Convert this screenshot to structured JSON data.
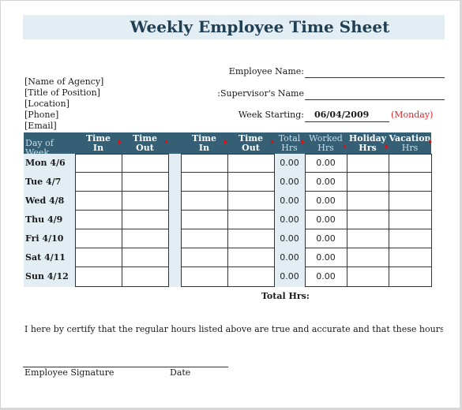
{
  "title": "Weekly Employee Time Sheet",
  "agency_info": [
    "[Name of Agency]",
    "[Title of Position]",
    "[Location]",
    "[Phone]",
    "[Email]"
  ],
  "fields": {
    "employee_name_label": "Employee Name:",
    "employee_name_value": "",
    "supervisor_name_label": "Supervisor's Name:",
    "supervisor_name_value": "",
    "week_starting_label": "Week Starting:",
    "week_starting_value": "06/04/2009",
    "week_starting_note": "(Monday)"
  },
  "table": {
    "headers": {
      "day": "Day of Week",
      "time_in_1": [
        "Time",
        "In"
      ],
      "time_out_1": [
        "Time",
        "Out"
      ],
      "time_in_2": [
        "Time",
        "In"
      ],
      "time_out_2": [
        "Time",
        "Out"
      ],
      "total": [
        "Total",
        "Hrs"
      ],
      "worked": [
        "Worked",
        "Hrs"
      ],
      "holiday": [
        "Holiday",
        "Hrs"
      ],
      "vacation": [
        "Vacation",
        "Hrs"
      ]
    },
    "rows": [
      {
        "day": "Mon 4/6",
        "total": "0.00",
        "worked": "0.00"
      },
      {
        "day": "Tue 4/7",
        "total": "0.00",
        "worked": "0.00"
      },
      {
        "day": "Wed 4/8",
        "total": "0.00",
        "worked": "0.00"
      },
      {
        "day": "Thu 4/9",
        "total": "0.00",
        "worked": "0.00"
      },
      {
        "day": "Fri 4/10",
        "total": "0.00",
        "worked": "0.00"
      },
      {
        "day": "Sat 4/11",
        "total": "0.00",
        "worked": "0.00"
      },
      {
        "day": "Sun 4/12",
        "total": "0.00",
        "worked": "0.00"
      }
    ],
    "total_label": "Total Hrs:"
  },
  "certification": "I here by certify that the regular hours listed above are true and accurate and that these hours represent the",
  "signature": {
    "employee_label": "Employee Signature",
    "date_label": "Date"
  },
  "colors": {
    "header_bg": "#345f75",
    "light_band": "#e2eef4",
    "title_color": "#213f52",
    "note_red": "#e0262b"
  }
}
